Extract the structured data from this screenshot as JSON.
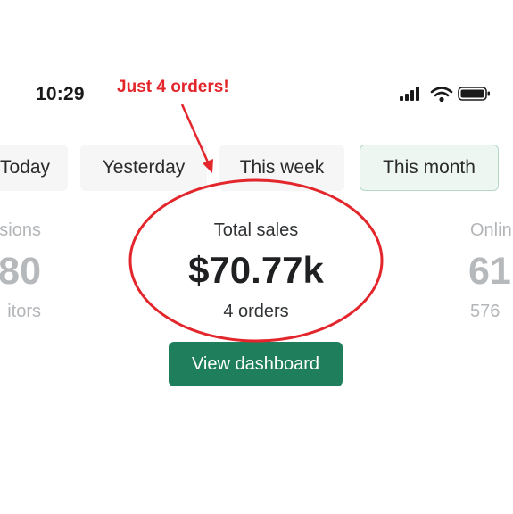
{
  "status_bar": {
    "time": "10:29",
    "icons": [
      "cellular-signal-icon",
      "wifi-icon",
      "battery-icon"
    ]
  },
  "annotation": {
    "text": "Just 4 orders!",
    "color": "#e3262b"
  },
  "date_tabs": [
    {
      "label": "Today",
      "selected": false
    },
    {
      "label": "Yesterday",
      "selected": false
    },
    {
      "label": "This week",
      "selected": false
    },
    {
      "label": "This month",
      "selected": true
    }
  ],
  "metrics": {
    "left": {
      "label": "sions",
      "value": "80",
      "sub": "itors"
    },
    "center": {
      "label": "Total sales",
      "value": "$70.77k",
      "sub": "4 orders"
    },
    "right": {
      "label": "Onlin",
      "value": "61",
      "sub": "576"
    }
  },
  "view_dashboard_label": "View dashboard",
  "colors": {
    "primary_button": "#1f7f5c",
    "selected_tab_bg": "#eef6f2",
    "selected_tab_border": "#b5d9c8",
    "annotation_red": "#e3262b"
  }
}
